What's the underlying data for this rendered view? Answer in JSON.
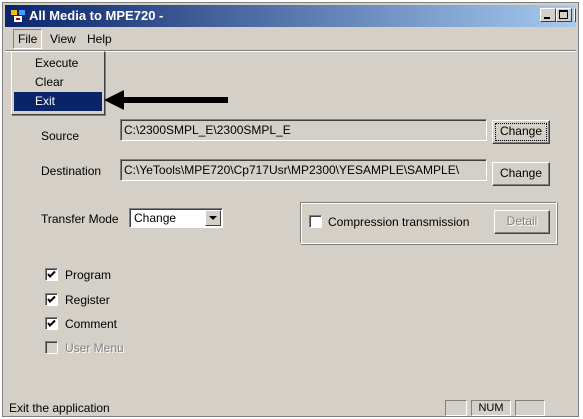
{
  "window": {
    "title": "All Media to MPE720 -"
  },
  "menubar": {
    "file": "File",
    "view": "View",
    "help": "Help"
  },
  "file_menu": {
    "items": [
      "Execute",
      "Clear",
      "Exit"
    ],
    "selected": "Exit"
  },
  "form": {
    "source_label": "Source",
    "source_value": "C:\\2300SMPL_E\\2300SMPL_E",
    "destination_label": "Destination",
    "destination_value": "C:\\YeTools\\MPE720\\Cp717Usr\\MP2300\\YESAMPLE\\SAMPLE\\",
    "change_label": "Change",
    "transfer_mode_label": "Transfer Mode",
    "transfer_mode_value": "Change",
    "compression_label": "Compression transmission",
    "detail_label": "Detail",
    "checkboxes": [
      {
        "label": "Program",
        "checked": true,
        "enabled": true
      },
      {
        "label": "Register",
        "checked": true,
        "enabled": true
      },
      {
        "label": "Comment",
        "checked": true,
        "enabled": true
      },
      {
        "label": "User Menu",
        "checked": false,
        "enabled": false
      }
    ]
  },
  "statusbar": {
    "text": "Exit the application",
    "num": "NUM"
  },
  "colors": {
    "titlebar": "#0a246a",
    "face": "#d4d0c8",
    "selection": "#0a246a"
  },
  "icons": [
    "app-icon",
    "minimize-icon",
    "maximize-icon",
    "close-icon",
    "arrow-icon",
    "dropdown-arrow-icon",
    "check-icon"
  ]
}
